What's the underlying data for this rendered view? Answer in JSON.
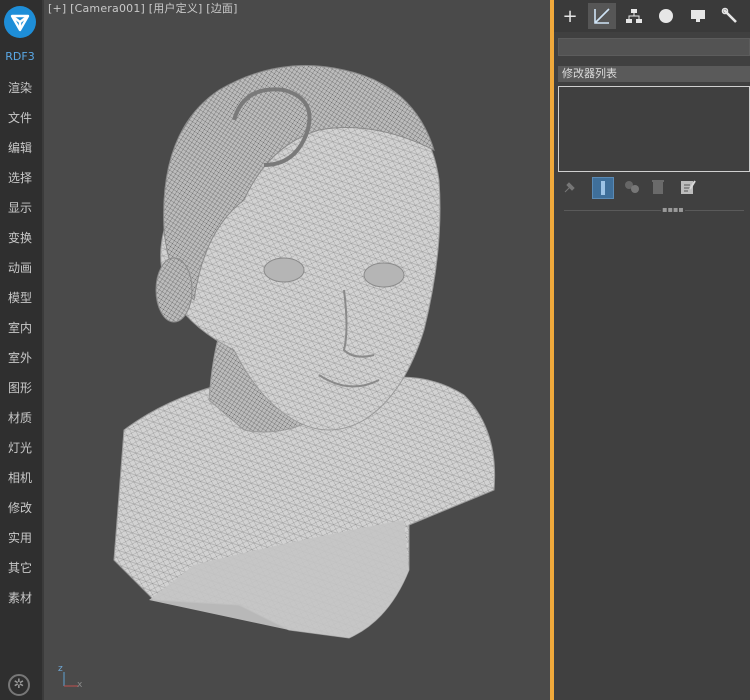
{
  "sidebar": {
    "logo_icon": "rdf-logo-icon",
    "brand": "RDF3",
    "items": [
      {
        "label": "渲染"
      },
      {
        "label": "文件"
      },
      {
        "label": "编辑"
      },
      {
        "label": "选择"
      },
      {
        "label": "显示"
      },
      {
        "label": "变换"
      },
      {
        "label": "动画"
      },
      {
        "label": "模型"
      },
      {
        "label": "室内"
      },
      {
        "label": "室外"
      },
      {
        "label": "图形"
      },
      {
        "label": "材质"
      },
      {
        "label": "灯光"
      },
      {
        "label": "相机"
      },
      {
        "label": "修改"
      },
      {
        "label": "实用"
      },
      {
        "label": "其它"
      },
      {
        "label": "素材"
      }
    ],
    "settings_icon": "gear-icon"
  },
  "viewport": {
    "label": "[+] [Camera001] [用户定义] [边面]",
    "axis": {
      "z": "z",
      "x": "x"
    },
    "background_color": "#4a4a4a",
    "active_border_color": "#f0a93b",
    "model": "bust-wireframe"
  },
  "panel": {
    "tabs": [
      {
        "icon": "create-plus-icon"
      },
      {
        "icon": "modify-icon"
      },
      {
        "icon": "hierarchy-icon"
      },
      {
        "icon": "motion-icon"
      },
      {
        "icon": "display-icon"
      },
      {
        "icon": "utilities-wrench-icon"
      }
    ],
    "modifier_list_label": "修改器列表",
    "stack_buttons": [
      {
        "icon": "pin-stack-icon"
      },
      {
        "icon": "show-end-result-icon"
      },
      {
        "icon": "make-unique-icon"
      },
      {
        "icon": "remove-modifier-icon"
      },
      {
        "icon": "configure-modifier-sets-icon"
      }
    ]
  }
}
